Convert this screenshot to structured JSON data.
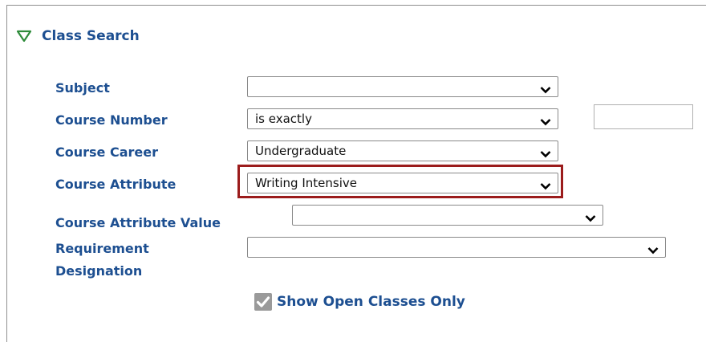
{
  "section": {
    "title": "Class Search",
    "expand_icon": "triangle-down-icon"
  },
  "fields": {
    "subject": {
      "label": "Subject",
      "value": ""
    },
    "course_number": {
      "label": "Course Number",
      "operator": "is exactly",
      "value": ""
    },
    "course_career": {
      "label": "Course Career",
      "value": "Undergraduate"
    },
    "course_attribute": {
      "label": "Course Attribute",
      "value": "Writing Intensive"
    },
    "course_attribute_value": {
      "label": "Course Attribute Value",
      "value": ""
    },
    "requirement_designation": {
      "label_line1": "Requirement",
      "label_line2": "Designation",
      "value": ""
    }
  },
  "options": {
    "show_open_classes_only": {
      "label": "Show Open Classes Only",
      "checked": true
    }
  },
  "colors": {
    "label_blue": "#1d4f91",
    "highlight_red": "#9b1c1c",
    "triangle_green": "#2e8b3a"
  }
}
